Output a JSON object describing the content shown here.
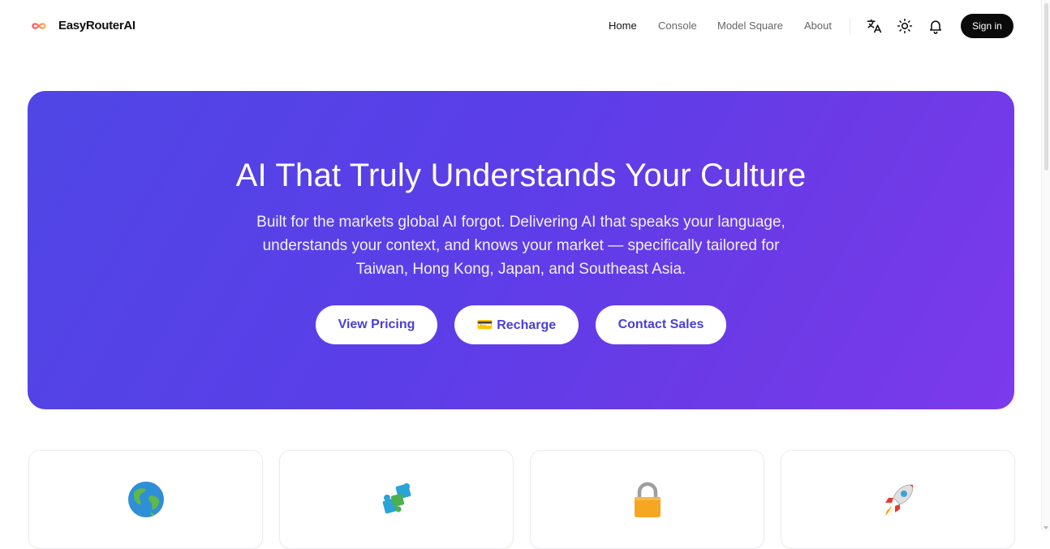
{
  "header": {
    "brand": "EasyRouterAI",
    "nav": [
      "Home",
      "Console",
      "Model Square",
      "About"
    ],
    "active_nav": "Home",
    "icons": [
      "translate-icon",
      "sun-icon",
      "bell-icon"
    ],
    "signin_label": "Sign in"
  },
  "hero": {
    "title": "AI That Truly Understands Your Culture",
    "subtitle": "Built for the markets global AI forgot. Delivering AI that speaks your language, understands your context, and knows your market — specifically tailored for Taiwan, Hong Kong, Japan, and Southeast Asia.",
    "buttons": [
      "View Pricing",
      "💳 Recharge",
      "Contact Sales"
    ],
    "gradient": [
      "#4f46e5",
      "#7c3aed"
    ],
    "button_text_color": "#4a3fd6"
  },
  "features": [
    {
      "icon": "globe-icon"
    },
    {
      "icon": "puzzle-icon"
    },
    {
      "icon": "lock-icon"
    },
    {
      "icon": "rocket-icon"
    }
  ],
  "colors": {
    "signin_bg": "#0a0a0a",
    "text": "#111111",
    "muted": "#666666"
  }
}
